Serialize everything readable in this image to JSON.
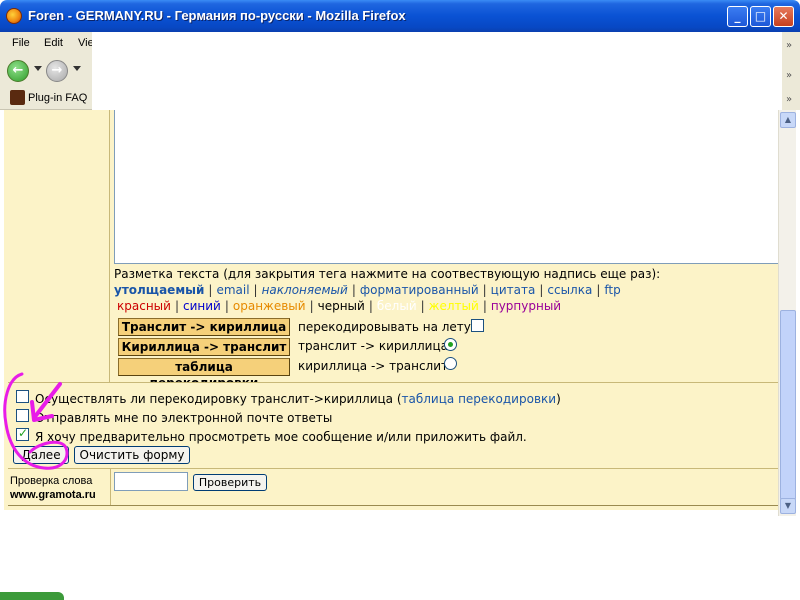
{
  "window": {
    "title": "Foren - GERMANY.RU - Германия по-русски - Mozilla Firefox",
    "buttons": {
      "minimize": "_",
      "maximize": "□",
      "close": "✕"
    }
  },
  "menu": {
    "file": "File",
    "edit": "Edit",
    "view": "Vie"
  },
  "nav": {
    "back": "←",
    "forward": "→"
  },
  "bookmarks": {
    "item": "Plug-in FAQ"
  },
  "markup": {
    "intro": "Разметка текста (для закрытия тега нажмите на соотвествующую надпись еще раз):",
    "tags": {
      "bold": "утолщаемый",
      "email": "email",
      "italic": "наклоняемый",
      "formatted": "форматированный",
      "quote": "цитата",
      "link": "ссылка",
      "ftp": "ftp"
    },
    "colors": {
      "red": "красный",
      "blue": "синий",
      "orange": "оранжевый",
      "black": "черный",
      "white": "белый",
      "yellow": "желтый",
      "purple": "пурпурный"
    },
    "separator": "|"
  },
  "translit": {
    "btn_translit_cyr": "Транслит -> кириллица",
    "btn_cyr_translit": "Кириллица -> транслит",
    "btn_table": "таблица перекодировки",
    "label_on_the_fly": "перекодировывать на лету:",
    "label_translit_cyr": "транслит -> кириллица",
    "label_cyr_translit": "кириллица -> транслит"
  },
  "options": {
    "opt1_text": "Осуществлять ли перекодировку транслит->кириллица (",
    "opt1_link": "таблица перекодировки",
    "opt1_close": ")",
    "opt2_text": "Отправлять мне по электронной почте ответы",
    "opt3_text": "Я хочу предварительно просмотреть мое сообщение и/или приложить файл.",
    "opt3_checked": true
  },
  "form": {
    "next": "Далее",
    "reset": "Очистить форму"
  },
  "spell": {
    "label": "Проверка слова",
    "site": "www.gramota.ru",
    "check": "Проверить",
    "input_value": ""
  },
  "scroll": {
    "up": "▲",
    "down": "▼"
  },
  "colors_map": {
    "link": "#1a55a8",
    "red": "#cc0000",
    "blue": "#0000cc",
    "orange": "#e68a00",
    "white": "#ffffff",
    "yellow": "#ffff00",
    "purple": "#990099",
    "annotation": "#e81ce8"
  }
}
